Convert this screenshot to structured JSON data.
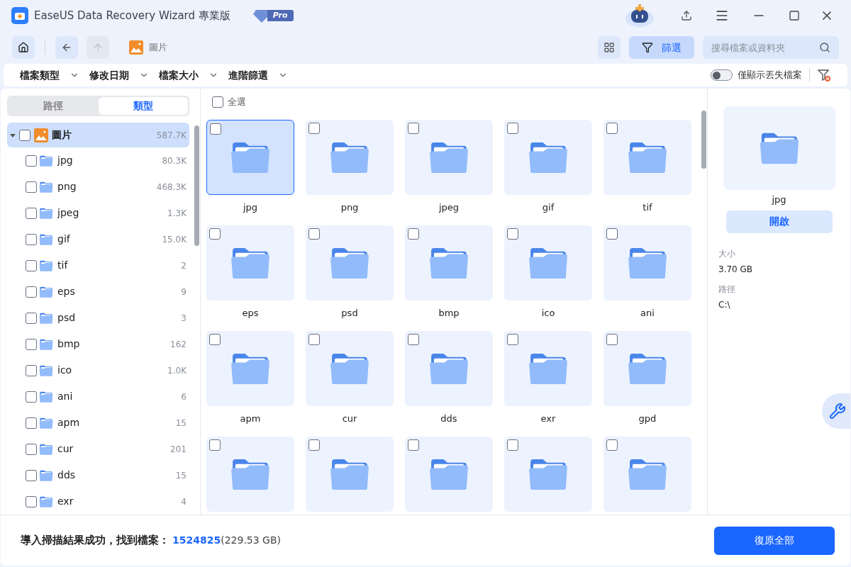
{
  "window": {
    "title": "EaseUS Data Recovery Wizard 專業版",
    "badge": "Pro"
  },
  "toolbar": {
    "breadcrumb": "圖片",
    "filter_button": {
      "label": "篩選",
      "selected": true
    },
    "search": {
      "placeholder": "搜尋檔案或資料夾"
    }
  },
  "filters": [
    {
      "label": "檔案類型"
    },
    {
      "label": "修改日期"
    },
    {
      "label": "檔案大小"
    },
    {
      "label": "進階篩選"
    }
  ],
  "lost_only": {
    "label": "僅顯示丟失檔案",
    "on": false
  },
  "sidebar": {
    "tabs": [
      {
        "label": "路徑",
        "selected": false
      },
      {
        "label": "類型",
        "selected": true
      }
    ],
    "tree": [
      {
        "label": "圖片",
        "count": "587.7K",
        "checked": false,
        "expanded": true,
        "selected": true,
        "children": [
          {
            "label": "jpg",
            "count": "80.3K",
            "checked": false
          },
          {
            "label": "png",
            "count": "468.3K",
            "checked": false
          },
          {
            "label": "jpeg",
            "count": "1.3K",
            "checked": false
          },
          {
            "label": "gif",
            "count": "15.0K",
            "checked": false
          },
          {
            "label": "tif",
            "count": "2",
            "checked": false
          },
          {
            "label": "eps",
            "count": "9",
            "checked": false
          },
          {
            "label": "psd",
            "count": "3",
            "checked": false
          },
          {
            "label": "bmp",
            "count": "162",
            "checked": false
          },
          {
            "label": "ico",
            "count": "1.0K",
            "checked": false
          },
          {
            "label": "ani",
            "count": "6",
            "checked": false
          },
          {
            "label": "apm",
            "count": "15",
            "checked": false
          },
          {
            "label": "cur",
            "count": "201",
            "checked": false
          },
          {
            "label": "dds",
            "count": "15",
            "checked": false
          },
          {
            "label": "exr",
            "count": "4",
            "checked": false
          }
        ]
      }
    ]
  },
  "grid": {
    "select_all": {
      "label": "全選",
      "checked": false
    },
    "items": [
      {
        "label": "jpg",
        "selected": true,
        "checked": false
      },
      {
        "label": "png",
        "selected": false,
        "checked": false
      },
      {
        "label": "jpeg",
        "selected": false,
        "checked": false
      },
      {
        "label": "gif",
        "selected": false,
        "checked": false
      },
      {
        "label": "tif",
        "selected": false,
        "checked": false
      },
      {
        "label": "eps",
        "selected": false,
        "checked": false
      },
      {
        "label": "psd",
        "selected": false,
        "checked": false
      },
      {
        "label": "bmp",
        "selected": false,
        "checked": false
      },
      {
        "label": "ico",
        "selected": false,
        "checked": false
      },
      {
        "label": "ani",
        "selected": false,
        "checked": false
      },
      {
        "label": "apm",
        "selected": false,
        "checked": false
      },
      {
        "label": "cur",
        "selected": false,
        "checked": false
      },
      {
        "label": "dds",
        "selected": false,
        "checked": false
      },
      {
        "label": "exr",
        "selected": false,
        "checked": false
      },
      {
        "label": "gpd",
        "selected": false,
        "checked": false
      },
      {
        "selected": false,
        "checked": false
      },
      {
        "selected": false,
        "checked": false
      },
      {
        "selected": false,
        "checked": false
      },
      {
        "selected": false,
        "checked": false
      },
      {
        "selected": false,
        "checked": false
      }
    ]
  },
  "details": {
    "name": "jpg",
    "open_button": "開啟",
    "fields": [
      {
        "label": "大小",
        "value": "3.70 GB"
      },
      {
        "label": "路徑",
        "value": "C:\\"
      }
    ]
  },
  "status_bar": {
    "message": "導入掃描結果成功，找到檔案：",
    "count": "1524825",
    "size": "(229.53 GB)",
    "recover_button": "復原全部"
  }
}
